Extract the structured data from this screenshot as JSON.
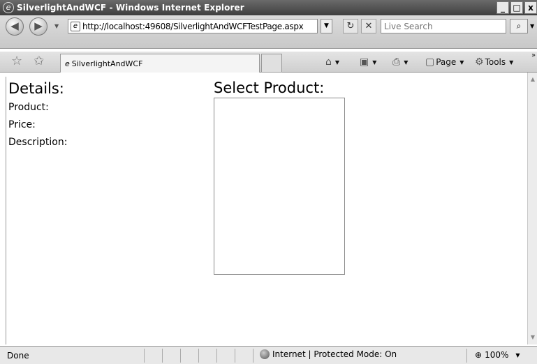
{
  "window": {
    "title": "SilverlightAndWCF - Windows Internet Explorer",
    "min": "_",
    "max": "□",
    "close": "x"
  },
  "nav": {
    "back": "◀",
    "forward": "▶",
    "dropdown": "▼",
    "url": "http://localhost:49608/SilverlightAndWCFTestPage.aspx",
    "address_dropdown": "▼",
    "refresh_glyph": "↻",
    "stop_glyph": "✕",
    "search_placeholder": "Live Search",
    "search_glyph": "⌕",
    "search_dropdown": "▼"
  },
  "favorites": {
    "tab_label": "SilverlightAndWCF"
  },
  "commands": {
    "home_glyph": "⌂",
    "feeds_glyph": "▣",
    "print_glyph": "⎙",
    "page_label": "Page",
    "tools_label": "Tools",
    "arrow": "▼",
    "more": "»"
  },
  "content": {
    "details_title": "Details:",
    "product_label": "Product:",
    "price_label": "Price:",
    "description_label": "Description:",
    "select_title": "Select Product:"
  },
  "status": {
    "text": "Done",
    "zone": "Internet | Protected Mode: On",
    "zoom": "100%",
    "zoom_glyph": "⊕"
  }
}
